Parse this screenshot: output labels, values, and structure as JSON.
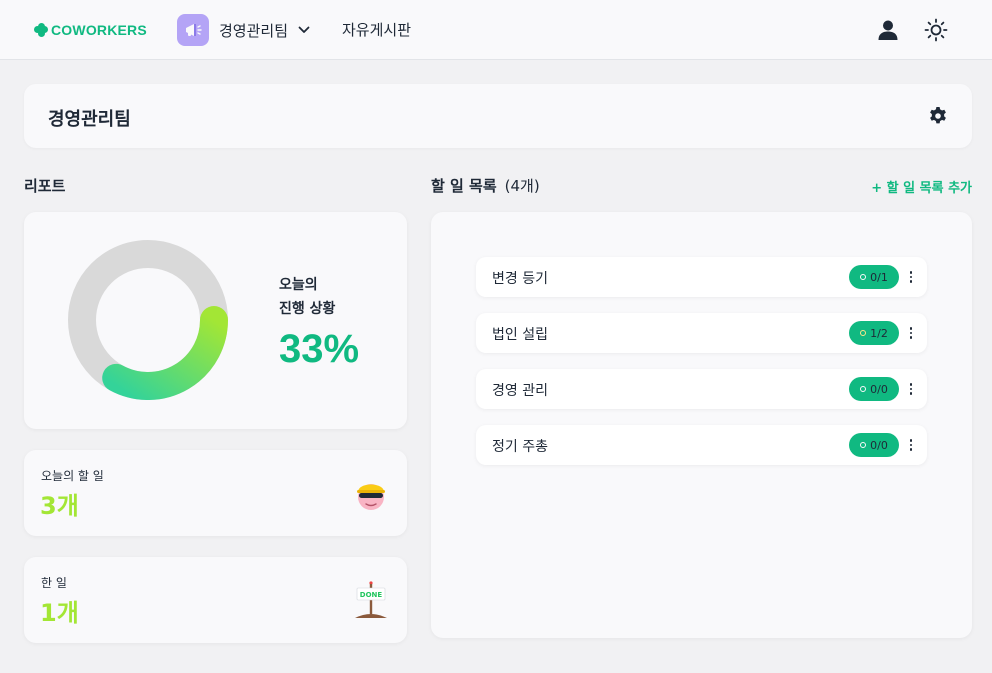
{
  "header": {
    "logo": "COWORKERS",
    "team_name": "경영관리팀",
    "board_link": "자유게시판",
    "icons": [
      "logo-icon",
      "megaphone-icon",
      "chevron-down-icon",
      "user-icon",
      "sun-icon"
    ]
  },
  "team_bar": {
    "title": "경영관리팀",
    "settings_icon": "gear-icon"
  },
  "report": {
    "section_title": "리포트",
    "progress_label_line1": "오늘의",
    "progress_label_line2": "진행 상황",
    "progress_value": "33%",
    "progress_fraction": 0.33,
    "today_label": "오늘의 할 일",
    "today_value": "3개",
    "done_label": "한 일",
    "done_value": "1개"
  },
  "todo": {
    "section_title": "할 일 목록",
    "count": "(4개)",
    "add_label": "+ 할 일 목록 추가",
    "items": [
      {
        "name": "변경 등기",
        "progress": "0/1"
      },
      {
        "name": "법인 설립",
        "progress": "1/2"
      },
      {
        "name": "경영 관리",
        "progress": "0/0"
      },
      {
        "name": "정기 주총",
        "progress": "0/0"
      }
    ]
  },
  "colors": {
    "brand": "#10b981",
    "accent_lime": "#a3e635",
    "team_avatar_bg": "#b4a4f6",
    "donut_track": "#d9d9d9"
  }
}
